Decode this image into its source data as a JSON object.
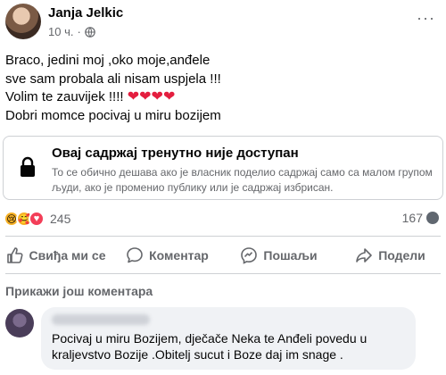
{
  "post": {
    "author": "Janja Jelkic",
    "time": "10 ч.",
    "separator": "·",
    "menu_label": "···",
    "lines": [
      "Braco, jedini moj ,oko moje,anđele",
      "sve sam probala ali nisam uspjela !!!",
      "Volim te zauvijek !!!! ",
      "Dobri momce pocivaj u miru bozijem"
    ],
    "hearts": "❤❤❤❤",
    "heart_color": "#e41e3f"
  },
  "unavailable": {
    "title": "Овај садржај тренутно није доступан",
    "description": "То се обично дешава ако је власник поделио садржај само са малом групом људи, ако је променио публику или је садржај избрисан."
  },
  "stats": {
    "reaction_icons": [
      "sad-face-icon",
      "care-face-icon",
      "love-heart-icon"
    ],
    "reactions_count": "245",
    "comments_count": "167"
  },
  "actions": {
    "like": "Свиђа ми се",
    "comment": "Коментар",
    "send": "Пошаљи",
    "share": "Подели"
  },
  "comments": {
    "view_more": "Прикажи још коментара",
    "items": [
      {
        "text": "Pocivaj u miru Bozijem, dječače Neka te Anđeli povedu u kraljevstvo Bozije .Obitelj sucut i Boze daj im snage ."
      }
    ]
  },
  "colors": {
    "secondary_text": "#65676b",
    "divider": "#ced0d4",
    "bubble": "#f0f2f5",
    "love": "#f33e58",
    "reaction_yellow": "#f7b125"
  }
}
